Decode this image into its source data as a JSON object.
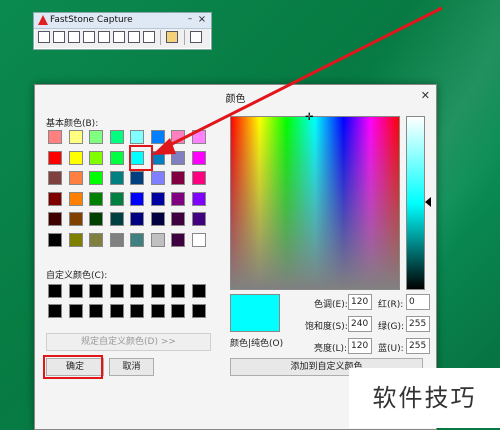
{
  "toolbar": {
    "app_title": "FastStone Capture",
    "minimize": "–",
    "close": "×",
    "tool_icons": [
      "capture-active-window-icon",
      "capture-window-object-icon",
      "capture-rectangle-icon",
      "capture-freehand-icon",
      "capture-fullscreen-icon",
      "capture-scrolling-icon",
      "capture-fixed-region-icon",
      "capture-video-icon",
      "output-settings-icon",
      "settings-icon"
    ]
  },
  "dialog": {
    "title": "颜色",
    "close": "✕",
    "basic_colors_label": "基本颜色(B):",
    "basic_colors": [
      [
        "#ff8080",
        "#ffff80",
        "#80ff80",
        "#00ff80",
        "#80ffff",
        "#0080ff",
        "#ff80c0",
        "#ff80ff"
      ],
      [
        "#ff0000",
        "#ffff00",
        "#80ff00",
        "#00ff40",
        "#00ffff",
        "#0080c0",
        "#8080c0",
        "#ff00ff"
      ],
      [
        "#804040",
        "#ff8040",
        "#00ff00",
        "#008080",
        "#004080",
        "#8080ff",
        "#800040",
        "#ff0080"
      ],
      [
        "#800000",
        "#ff8000",
        "#008000",
        "#008040",
        "#0000ff",
        "#0000a0",
        "#800080",
        "#8000ff"
      ],
      [
        "#400000",
        "#804000",
        "#004000",
        "#004040",
        "#000080",
        "#000040",
        "#400040",
        "#400080"
      ],
      [
        "#000000",
        "#808000",
        "#808040",
        "#808080",
        "#408080",
        "#c0c0c0",
        "#400040",
        "#ffffff"
      ]
    ],
    "selected_swatch": "#00ffff",
    "custom_colors_label": "自定义颜色(C):",
    "define_custom_button": "规定自定义颜色(D) >>",
    "ok_button": "确定",
    "cancel_button": "取消",
    "preview_label": "颜色|纯色(O)",
    "preview_color": "#00ffff",
    "hue_label": "色调(E):",
    "hue_value": "120",
    "sat_label": "饱和度(S):",
    "sat_value": "240",
    "lum_label": "亮度(L):",
    "lum_value": "120",
    "red_label": "红(R):",
    "red_value": "0",
    "green_label": "绿(G):",
    "green_value": "255",
    "blue_label": "蓝(U):",
    "blue_value": "255",
    "add_custom_button": "添加到自定义颜色"
  },
  "watermark": "软件技巧",
  "colors": {
    "annotation_red": "#e0161b"
  }
}
